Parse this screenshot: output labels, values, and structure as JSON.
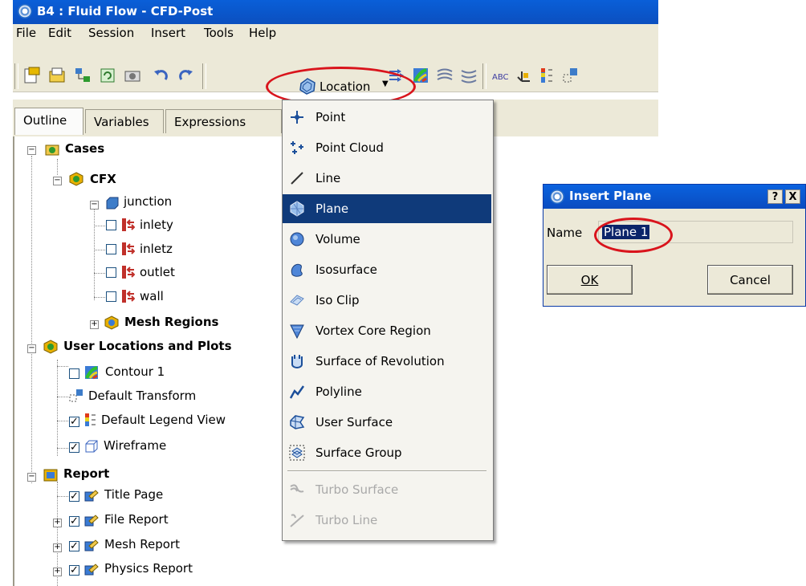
{
  "window": {
    "title": "B4 : Fluid Flow - CFD-Post"
  },
  "menubar": {
    "items": [
      "File",
      "Edit",
      "Session",
      "Insert",
      "Tools",
      "Help"
    ]
  },
  "toolbar": {
    "location_label": "Location"
  },
  "tabs": [
    "Outline",
    "Variables",
    "Expressions"
  ],
  "tree": {
    "cases": "Cases",
    "cfx": "CFX",
    "junction": "junction",
    "junction_children": [
      "inlety",
      "inletz",
      "outlet",
      "wall"
    ],
    "mesh_regions": "Mesh Regions",
    "user_locations": "User Locations and Plots",
    "user_children": [
      "Contour 1",
      "Default Transform",
      "Default Legend View",
      "Wireframe"
    ],
    "report": "Report",
    "report_children": [
      "Title Page",
      "File Report",
      "Mesh Report",
      "Physics Report"
    ]
  },
  "location_menu": {
    "items": [
      "Point",
      "Point Cloud",
      "Line",
      "Plane",
      "Volume",
      "Isosurface",
      "Iso Clip",
      "Vortex Core Region",
      "Surface of Revolution",
      "Polyline",
      "User Surface",
      "Surface Group"
    ],
    "disabled_items": [
      "Turbo Surface",
      "Turbo Line"
    ],
    "selected": "Plane"
  },
  "dialog": {
    "title": "Insert Plane",
    "help_button": "?",
    "close_button": "X",
    "name_label": "Name",
    "name_value": "Plane 1",
    "ok_label": "OK",
    "cancel_label": "Cancel"
  },
  "colors": {
    "titlebar": "#0a5fd8",
    "selection": "#0f3a7a",
    "highlight_circle": "#d9141c",
    "chrome": "#ece9d8"
  }
}
